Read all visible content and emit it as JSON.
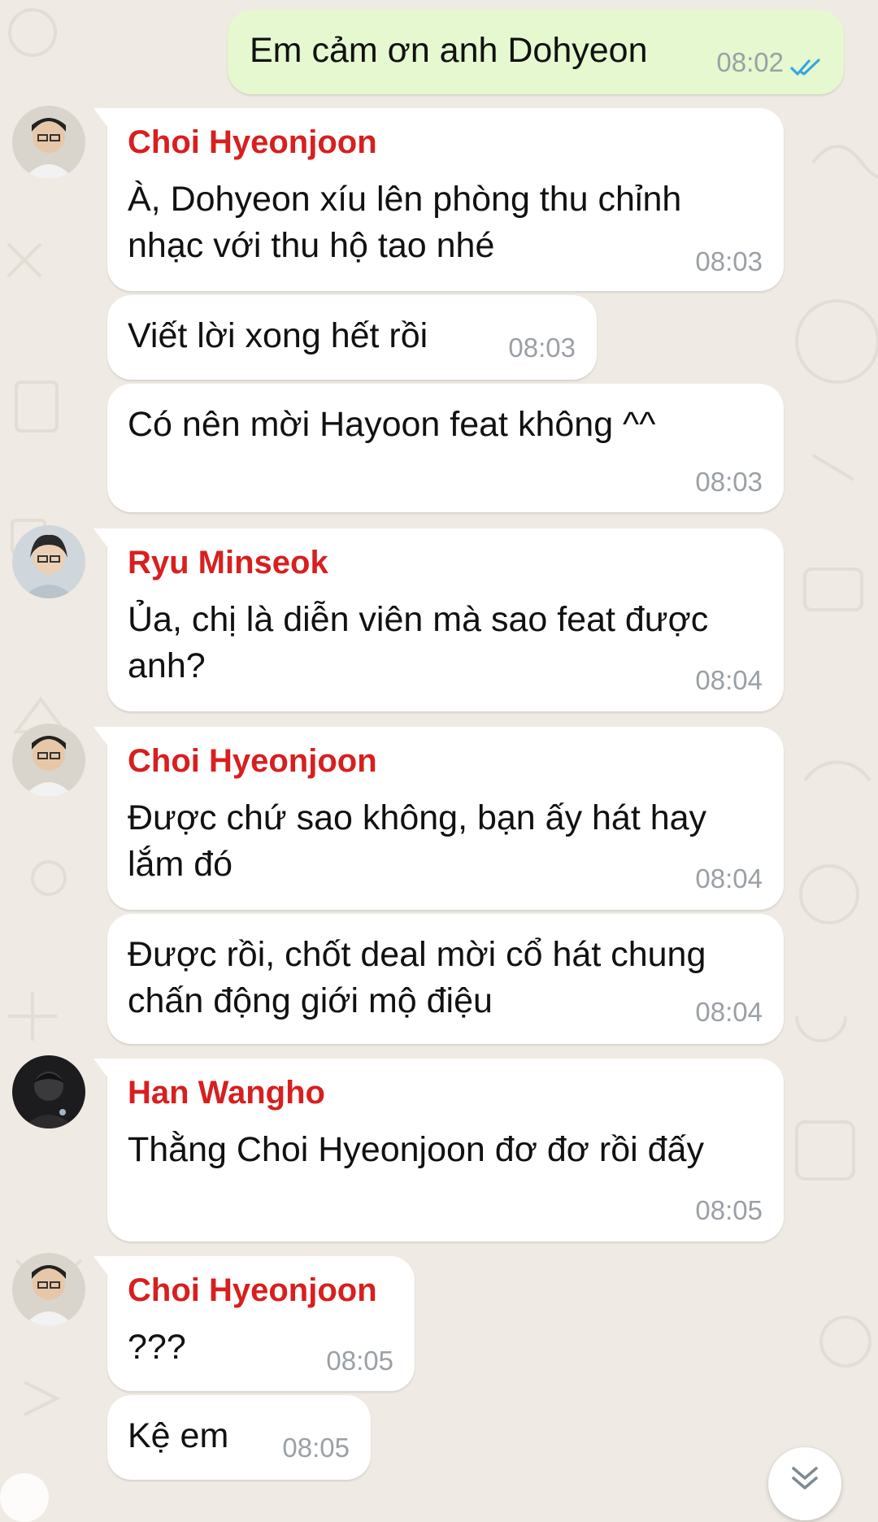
{
  "outgoing": {
    "text": "Em cảm ơn anh Dohyeon",
    "time": "08:02",
    "status_icon": "double-check-icon",
    "read_color": "#34a8e0"
  },
  "groups": [
    {
      "sender": "Choi Hyeonjoon",
      "avatar": "avatar-choi-hyeonjoon",
      "messages": [
        {
          "lines": [
            "À, Dohyeon xíu lên phòng thu chỉnh",
            "nhạc với thu hộ tao nhé"
          ],
          "time": "08:03"
        },
        {
          "lines": [
            "Viết lời xong hết rồi"
          ],
          "time": "08:03"
        },
        {
          "lines": [
            "Có nên mời Hayoon feat không ^^"
          ],
          "time": "08:03"
        }
      ]
    },
    {
      "sender": "Ryu Minseok",
      "avatar": "avatar-ryu-minseok",
      "messages": [
        {
          "lines": [
            "Ủa, chị là diễn viên mà sao feat được",
            "anh?"
          ],
          "time": "08:04"
        }
      ]
    },
    {
      "sender": "Choi Hyeonjoon",
      "avatar": "avatar-choi-hyeonjoon",
      "messages": [
        {
          "lines": [
            "Được chứ sao không, bạn ấy hát hay",
            "lắm đó"
          ],
          "time": "08:04"
        },
        {
          "lines": [
            "Được rồi, chốt deal mời cổ hát chung",
            "chấn động giới mộ điệu"
          ],
          "time": "08:04"
        }
      ]
    },
    {
      "sender": "Han Wangho",
      "avatar": "avatar-han-wangho",
      "messages": [
        {
          "lines": [
            "Thằng Choi Hyeonjoon đơ đơ rồi đấy"
          ],
          "time": "08:05"
        }
      ]
    },
    {
      "sender": "Choi Hyeonjoon",
      "avatar": "avatar-choi-hyeonjoon",
      "messages": [
        {
          "lines": [
            "???"
          ],
          "time": "08:05"
        },
        {
          "lines": [
            "Kệ em"
          ],
          "time": "08:05"
        }
      ]
    }
  ],
  "scroll_down_icon": "double-chevron-down-icon",
  "colors": {
    "background": "#efeae3",
    "bubble_in": "#ffffff",
    "bubble_out": "#e5f8cf",
    "sender_name": "#d81f1f",
    "timestamp": "#9aa0a6"
  }
}
